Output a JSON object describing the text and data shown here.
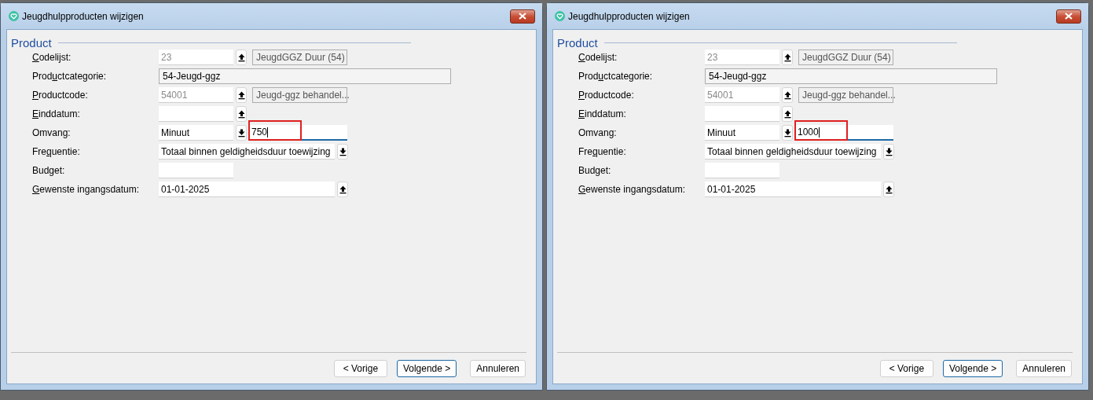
{
  "dialogs": [
    {
      "title": "Jeugdhulpproducten wijzigen",
      "section": "Product",
      "fields": [
        {
          "label_key": "C",
          "label_post": "odelijst:",
          "kind": "short",
          "value": "23",
          "readonly": true,
          "up_button": true,
          "description": "JeugdGGZ Duur (54)"
        },
        {
          "label_pre": "Prod",
          "label_key": "u",
          "label_post": "ctcategorie:",
          "kind": "display",
          "value": "54-Jeugd-ggz"
        },
        {
          "label_key": "P",
          "label_post": "roductcode:",
          "kind": "short",
          "value": "54001",
          "readonly": true,
          "up_button": true,
          "description": "Jeugd-ggz behandel..."
        },
        {
          "label_key": "E",
          "label_post": "inddatum:",
          "kind": "short",
          "up_button": true
        },
        {
          "label": "Omvang:",
          "kind": "short",
          "value": "Minuut",
          "readonly": false,
          "down_button": true,
          "secondary": {
            "value": "750",
            "focused": true,
            "highlighted": true
          }
        },
        {
          "label_pre": "Fre",
          "label_key": "q",
          "label_post": "uentie:",
          "kind": "long",
          "value": "Totaal binnen geldigheidsduur toewijzing",
          "readonly": false,
          "down_button": true
        },
        {
          "label": "Budget:",
          "kind": "short"
        },
        {
          "label_key": "G",
          "label_post": "ewenste ingangsdatum:",
          "kind": "long",
          "value": "01-01-2025",
          "readonly": false,
          "up_button": true
        }
      ],
      "buttons": [
        {
          "label": "< Vorige",
          "default": false
        },
        {
          "label": "Volgende >",
          "default": true
        },
        {
          "label": "Annuleren",
          "default": false
        }
      ]
    },
    {
      "title": "Jeugdhulpproducten wijzigen",
      "section": "Product",
      "fields": [
        {
          "label_key": "C",
          "label_post": "odelijst:",
          "kind": "short",
          "value": "23",
          "readonly": true,
          "up_button": true,
          "description": "JeugdGGZ Duur (54)"
        },
        {
          "label_pre": "Prod",
          "label_key": "u",
          "label_post": "ctcategorie:",
          "kind": "display",
          "value": "54-Jeugd-ggz"
        },
        {
          "label_key": "P",
          "label_post": "roductcode:",
          "kind": "short",
          "value": "54001",
          "readonly": true,
          "up_button": true,
          "description": "Jeugd-ggz behandel..."
        },
        {
          "label_key": "E",
          "label_post": "inddatum:",
          "kind": "short",
          "up_button": true
        },
        {
          "label": "Omvang:",
          "kind": "short",
          "value": "Minuut",
          "readonly": false,
          "down_button": true,
          "secondary": {
            "value": "1000",
            "focused": true,
            "highlighted": true
          }
        },
        {
          "label_pre": "Fre",
          "label_key": "q",
          "label_post": "uentie:",
          "kind": "long",
          "value": "Totaal binnen geldigheidsduur toewijzing",
          "readonly": false,
          "down_button": true
        },
        {
          "label": "Budget:",
          "kind": "short"
        },
        {
          "label_key": "G",
          "label_post": "ewenste ingangsdatum:",
          "kind": "long",
          "value": "01-01-2025",
          "readonly": false,
          "up_button": true
        }
      ],
      "buttons": [
        {
          "label": "< Vorige",
          "default": false
        },
        {
          "label": "Volgende >",
          "default": true
        },
        {
          "label": "Annuleren",
          "default": false
        }
      ]
    }
  ]
}
